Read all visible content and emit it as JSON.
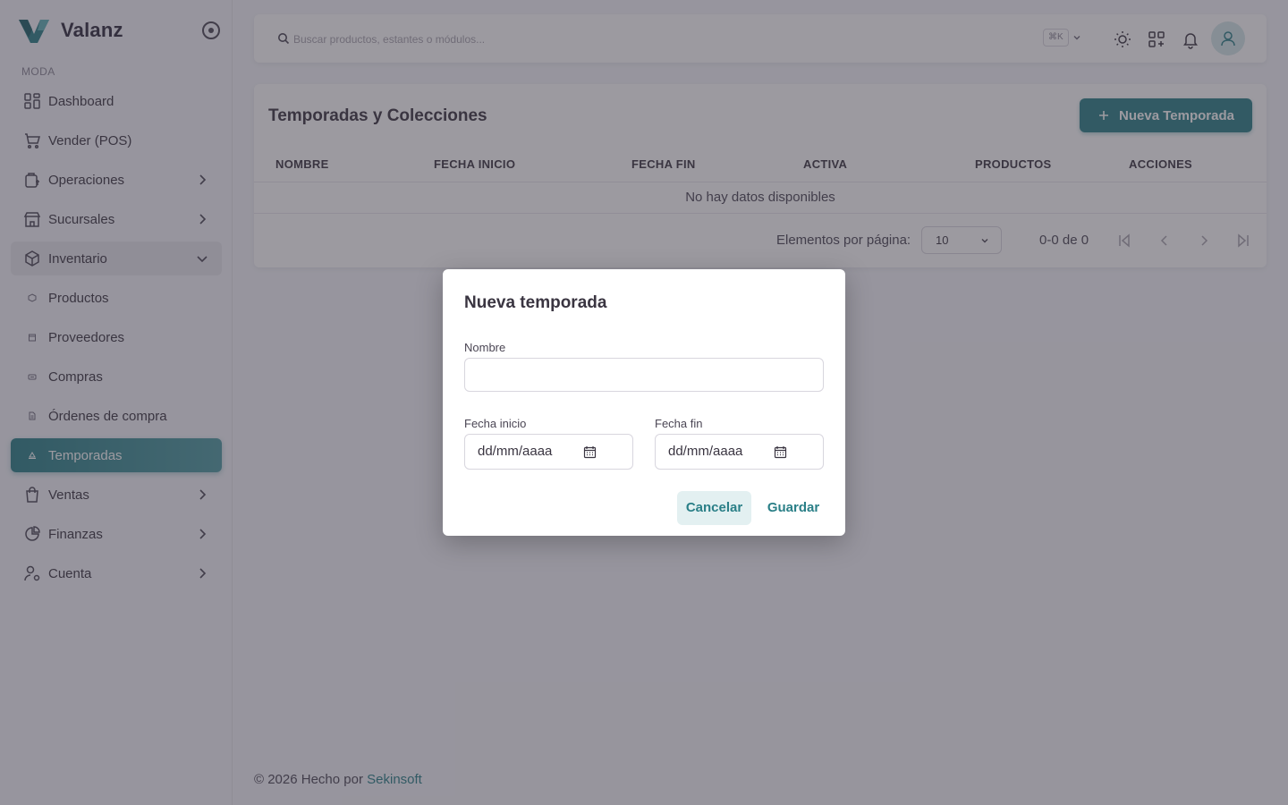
{
  "brand": {
    "name": "Valanz"
  },
  "sidebar": {
    "section_title": "MODA",
    "items": [
      {
        "label": "Dashboard",
        "icon": "dashboard-icon"
      },
      {
        "label": "Vender (POS)",
        "icon": "cart-icon"
      },
      {
        "label": "Operaciones",
        "icon": "operations-icon"
      },
      {
        "label": "Sucursales",
        "icon": "store-icon"
      },
      {
        "label": "Inventario",
        "icon": "box-icon"
      },
      {
        "label": "Productos",
        "icon": "product-dot-icon"
      },
      {
        "label": "Proveedores",
        "icon": "supplier-dot-icon"
      },
      {
        "label": "Compras",
        "icon": "purchases-dot-icon"
      },
      {
        "label": "Órdenes de compra",
        "icon": "purchase-order-dot-icon"
      },
      {
        "label": "Temporadas",
        "icon": "season-dot-icon"
      },
      {
        "label": "Ventas",
        "icon": "bag-icon"
      },
      {
        "label": "Finanzas",
        "icon": "pie-chart-icon"
      },
      {
        "label": "Cuenta",
        "icon": "user-settings-icon"
      }
    ]
  },
  "topbar": {
    "search_placeholder": "Buscar productos, estantes o módulos...",
    "shortcut": "⌘K"
  },
  "page": {
    "title": "Temporadas y Colecciones",
    "new_button": "Nueva Temporada",
    "columns": [
      "NOMBRE",
      "FECHA INICIO",
      "FECHA FIN",
      "ACTIVA",
      "PRODUCTOS",
      "ACCIONES"
    ],
    "empty_text": "No hay datos disponibles",
    "pagination": {
      "per_page_label": "Elementos por página:",
      "per_page_value": "10",
      "range": "0-0 de 0"
    }
  },
  "footer": {
    "text": "© 2026 Hecho por ",
    "link": "Sekinsoft"
  },
  "dialog": {
    "title": "Nueva temporada",
    "name_label": "Nombre",
    "name_value": "",
    "start_label": "Fecha inicio",
    "start_value": "dd/mm/aaaa",
    "end_label": "Fecha fin",
    "end_value": "dd/mm/aaaa",
    "cancel_label": "Cancelar",
    "save_label": "Guardar"
  },
  "colors": {
    "accent": "#2a7f87",
    "overlay": "rgba(58,53,65,0.5)"
  }
}
